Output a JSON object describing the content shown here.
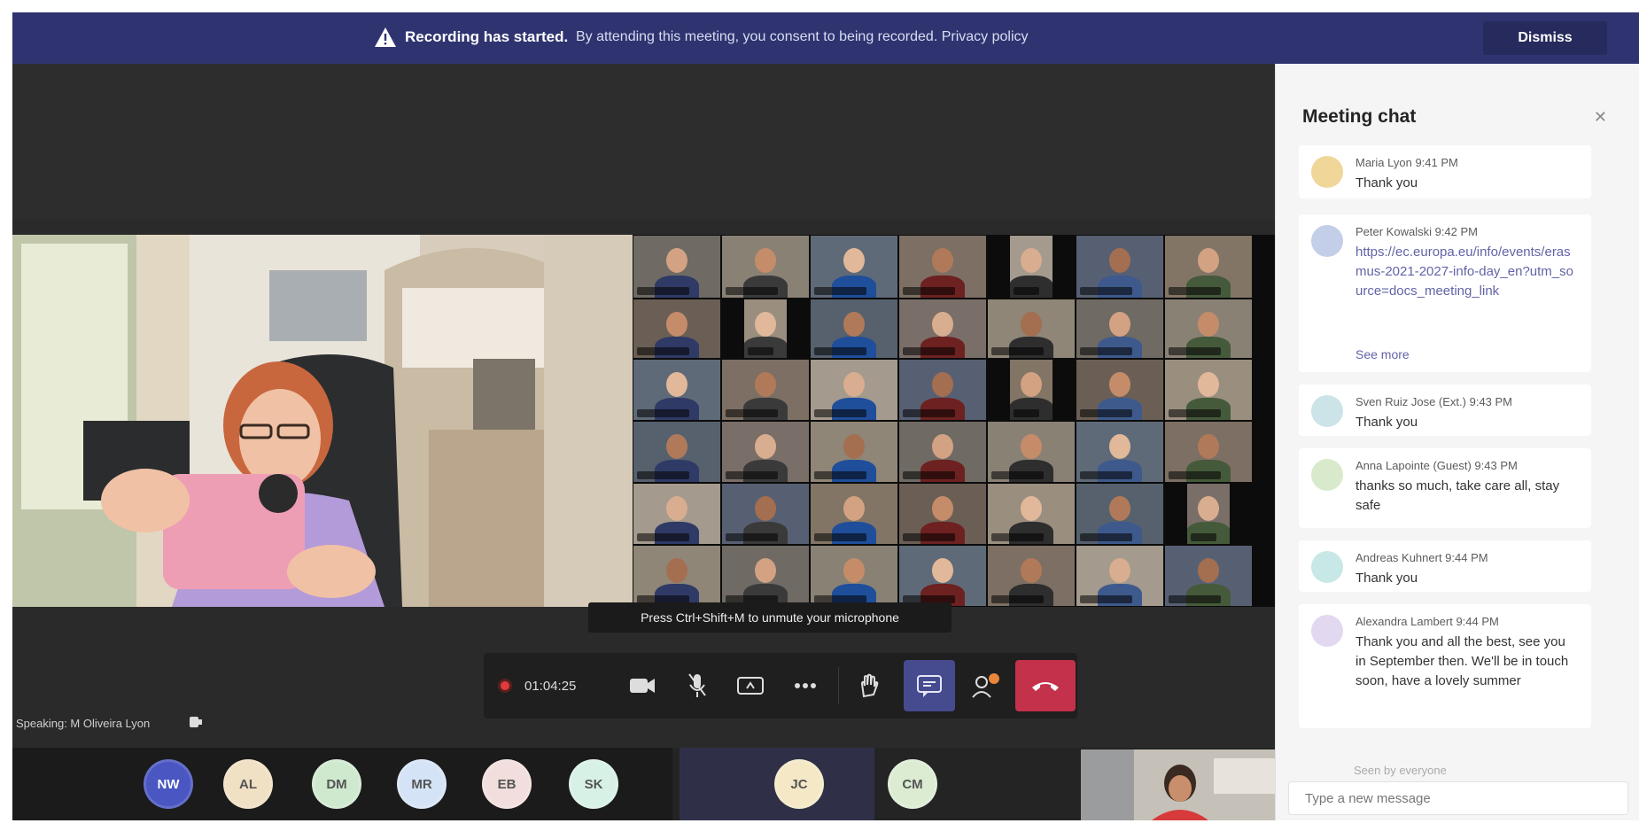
{
  "banner": {
    "bold_text": "Recording has started.",
    "message": "By attending this meeting, you consent to being recorded. Privacy policy",
    "dismiss_label": "Dismiss"
  },
  "stage": {
    "hint": "Press Ctrl+Shift+M to unmute your microphone",
    "speaking": "Speaking: M Oliveira Lyon"
  },
  "controls": {
    "timer": "01:04:25"
  },
  "roster": [
    {
      "initials": "NW",
      "color": "#4a56c1"
    },
    {
      "initials": "AL",
      "color": "#f0e0c4"
    },
    {
      "initials": "DM",
      "color": "#cfe9cf"
    },
    {
      "initials": "MR",
      "color": "#d5e3f6"
    },
    {
      "initials": "EB",
      "color": "#f2dedc"
    },
    {
      "initials": "SK",
      "color": "#d7f1e7"
    },
    {
      "initials": "JC",
      "color": "#f4e8c6"
    },
    {
      "initials": "CM",
      "color": "#dcecd3"
    }
  ],
  "chat": {
    "title": "Meeting chat",
    "messages": [
      {
        "meta": "Maria Lyon  9:41 PM",
        "text": "Thank you",
        "color": "#f1d69a"
      },
      {
        "meta": "Peter Kowalski  9:42 PM",
        "text": "https://ec.europa.eu/info/events/erasmus-2021-2027-info-day_en?utm_source=docs_meeting_link",
        "extra": "See more",
        "color": "#c3cee9"
      },
      {
        "meta": "Sven Ruiz Jose (Ext.)  9:43 PM",
        "text": "Thank you",
        "color": "#cce3e8"
      },
      {
        "meta": "Anna Lapointe (Guest)  9:43 PM",
        "text": "thanks so much, take care all, stay safe",
        "color": "#d9eacc"
      },
      {
        "meta": "Andreas Kuhnert  9:44 PM",
        "text": "Thank you",
        "color": "#c7e8e6"
      },
      {
        "meta": "Alexandra Lambert  9:44 PM",
        "text": "Thank you and all the best, see you in September then. We'll be in touch soon, have a lovely summer",
        "color": "#e2d8ef"
      }
    ],
    "seen_text": "Seen by everyone",
    "compose_placeholder": "Type a new message"
  }
}
